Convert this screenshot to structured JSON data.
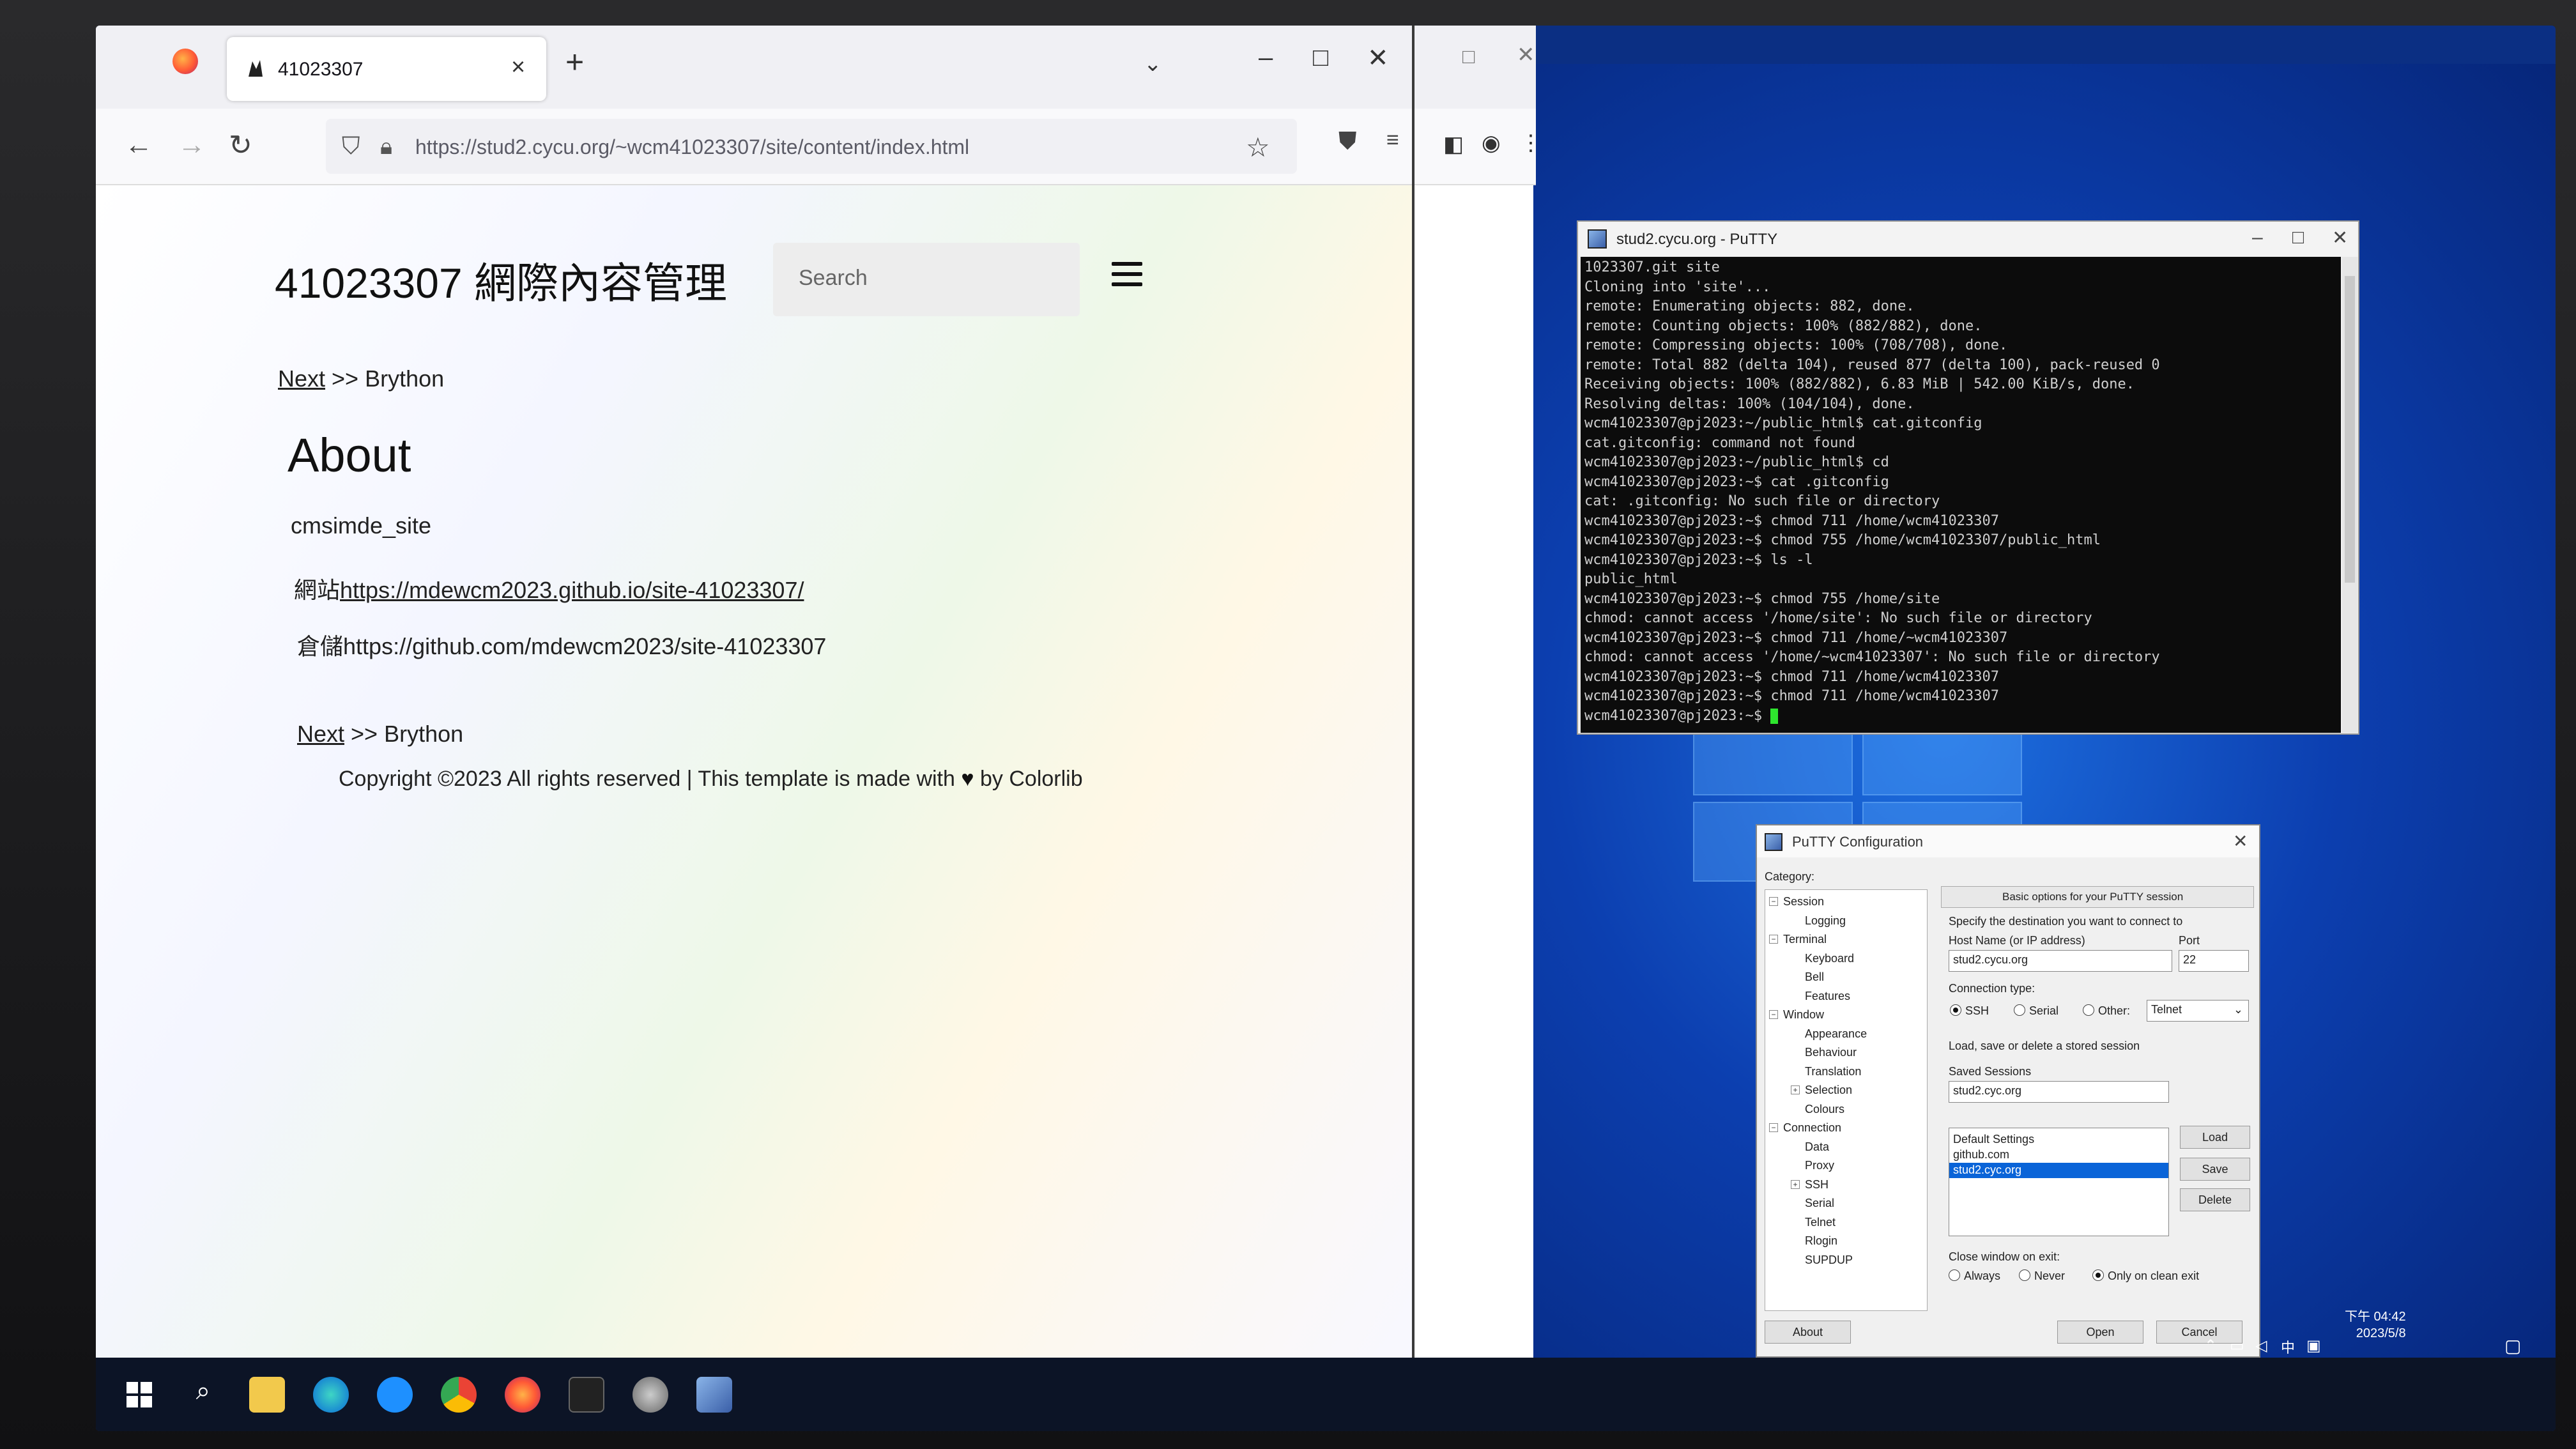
{
  "firefox": {
    "tab_title": "41023307",
    "tab_close": "×",
    "new_tab": "+",
    "tablist": "⌄",
    "minimize": "–",
    "maximize": "□",
    "close": "✕",
    "back": "←",
    "forward": "→",
    "reload": "↻",
    "url": "https://stud2.cycu.org/~wcm41023307/site/content/index.html",
    "star": "☆"
  },
  "page": {
    "site_title": "41023307 網際內容管理",
    "search_placeholder": "Search",
    "nav_top": {
      "next": "Next",
      "sep": " >> ",
      "target": "Brython"
    },
    "heading": "About",
    "line1": "cmsimde_site",
    "line2_prefix": "網站",
    "line2_link": "https://mdewcm2023.github.io/site-41023307/",
    "line3_prefix": "倉儲",
    "line3_link": "https://github.com/mdewcm2023/site-41023307",
    "nav_bottom": {
      "next": "Next",
      "sep": " >> ",
      "target": "Brython"
    },
    "copyright_pre": "Copyright ©2023 All rights reserved | This template is made with",
    "copyright_heart": "♥",
    "copyright_post": "by Colorlib"
  },
  "putty": {
    "title": "stud2.cycu.org - PuTTY",
    "lines": [
      "1023307.git site",
      "Cloning into 'site'...",
      "remote: Enumerating objects: 882, done.",
      "remote: Counting objects: 100% (882/882), done.",
      "remote: Compressing objects: 100% (708/708), done.",
      "remote: Total 882 (delta 104), reused 877 (delta 100), pack-reused 0",
      "Receiving objects: 100% (882/882), 6.83 MiB | 542.00 KiB/s, done.",
      "Resolving deltas: 100% (104/104), done.",
      "wcm41023307@pj2023:~/public_html$ cat.gitconfig",
      "cat.gitconfig: command not found",
      "wcm41023307@pj2023:~/public_html$ cd",
      "wcm41023307@pj2023:~$ cat .gitconfig",
      "cat: .gitconfig: No such file or directory",
      "wcm41023307@pj2023:~$ chmod 711 /home/wcm41023307",
      "wcm41023307@pj2023:~$ chmod 755 /home/wcm41023307/public_html",
      "wcm41023307@pj2023:~$ ls -l",
      "public_html",
      "wcm41023307@pj2023:~$ chmod 755 /home/site",
      "chmod: cannot access '/home/site': No such file or directory",
      "wcm41023307@pj2023:~$ chmod 711 /home/~wcm41023307",
      "chmod: cannot access '/home/~wcm41023307': No such file or directory",
      "wcm41023307@pj2023:~$ chmod 711 /home/wcm41023307",
      "wcm41023307@pj2023:~$ chmod 711 /home/wcm41023307",
      "wcm41023307@pj2023:~$ "
    ]
  },
  "config": {
    "title": "PuTTY Configuration",
    "category_label": "Category:",
    "tree": [
      "Session",
      "Logging",
      "Terminal",
      "Keyboard",
      "Bell",
      "Features",
      "Window",
      "Appearance",
      "Behaviour",
      "Translation",
      "Selection",
      "Colours",
      "Connection",
      "Data",
      "Proxy",
      "SSH",
      "Serial",
      "Telnet",
      "Rlogin",
      "SUPDUP"
    ],
    "group_header": "Basic options for your PuTTY session",
    "destination_label": "Specify the destination you want to connect to",
    "host_label": "Host Name (or IP address)",
    "port_label": "Port",
    "host_value": "stud2.cycu.org",
    "port_value": "22",
    "conn_type_label": "Connection type:",
    "conn_ssh": "SSH",
    "conn_serial": "Serial",
    "conn_other": "Other:",
    "conn_other_select": "Telnet",
    "load_save_label": "Load, save or delete a stored session",
    "saved_sessions_label": "Saved Sessions",
    "saved_session_value": "stud2.cyc.org",
    "sessions": [
      "Default Settings",
      "github.com",
      "stud2.cyc.org"
    ],
    "btn_load": "Load",
    "btn_save": "Save",
    "btn_delete": "Delete",
    "close_label": "Close window on exit:",
    "close_always": "Always",
    "close_never": "Never",
    "close_clean": "Only on clean exit",
    "btn_about": "About",
    "btn_open": "Open",
    "btn_cancel": "Cancel"
  },
  "tray": {
    "time": "下午 04:42",
    "date": "2023/5/8"
  }
}
